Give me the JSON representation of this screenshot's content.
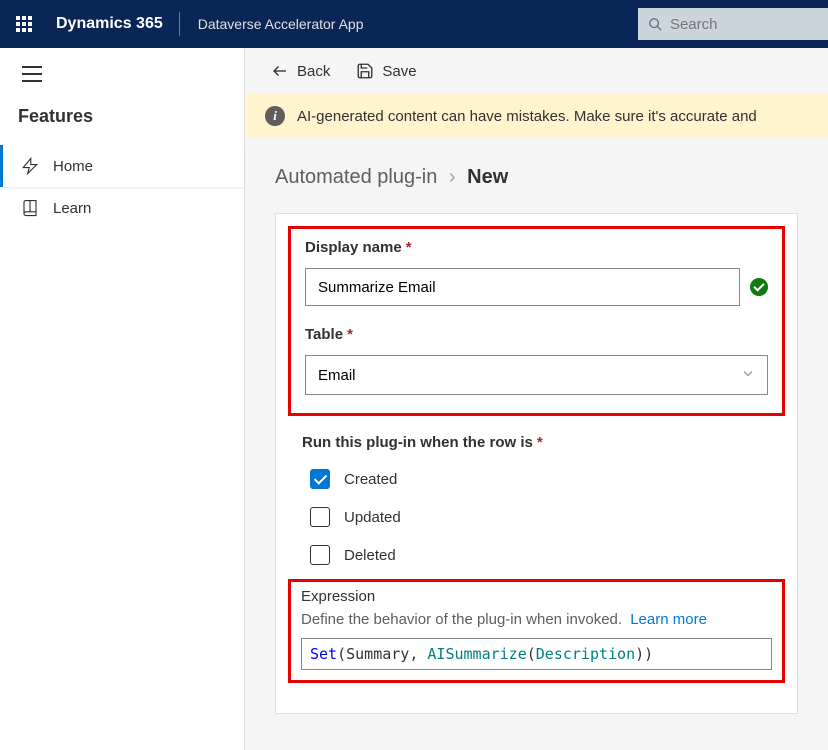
{
  "topbar": {
    "brand": "Dynamics 365",
    "app_title": "Dataverse Accelerator App",
    "search_placeholder": "Search"
  },
  "sidebar": {
    "heading": "Features",
    "items": [
      {
        "label": "Home"
      },
      {
        "label": "Learn"
      }
    ]
  },
  "cmdbar": {
    "back": "Back",
    "save": "Save"
  },
  "banner": {
    "text": "AI-generated content can have mistakes. Make sure it's accurate and"
  },
  "breadcrumb": {
    "parent": "Automated plug-in",
    "current": "New"
  },
  "form": {
    "display_name_label": "Display name",
    "display_name_value": "Summarize Email",
    "table_label": "Table",
    "table_value": "Email",
    "run_label": "Run this plug-in when the row is",
    "triggers": {
      "created": "Created",
      "updated": "Updated",
      "deleted": "Deleted"
    },
    "expr_title": "Expression",
    "expr_desc": "Define the behavior of the plug-in when invoked.",
    "learn_more": "Learn more",
    "expr_code": {
      "set": "Set",
      "arg1": "Summary",
      "fn": "AISummarize",
      "arg2": "Description"
    }
  }
}
